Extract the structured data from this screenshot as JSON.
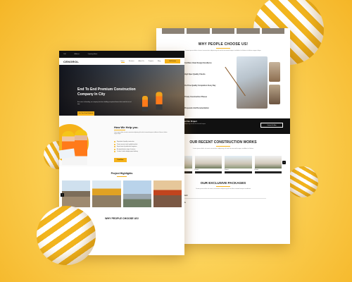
{
  "back_page": {
    "why_title": "WHY PEOPLE CHOOSE US!",
    "why_subtitle": "Lorem ipsum dolor sit amet consectetur adipiscing elit sed do eiusmod tempor incididunt ut labore et dolore magna aliqua",
    "features": [
      "Certified, Clear Design Excellence",
      "High Spec Quality Checks",
      "On-Time Quality Completion Every Day",
      "Timely Construction Phases",
      "Proposals And Documentation"
    ],
    "banner": {
      "title": "Any Further Question About Our Project",
      "text": "Lorem ipsum dolor sit amet consectetur adipiscing elit sed do eiusmod tempor",
      "button": "Contact Us Now"
    },
    "recent_title": "OUR RECENT CONSTRUCTION WORKS",
    "recent_subtitle": "Lorem ipsum dolor sit amet consectetur adipiscing elit sed do eiusmod tempor incididunt ut labore",
    "projects": [
      "Project",
      "Project",
      "Project",
      "Project"
    ],
    "packages_title": "OUR EXCLUSIVE PACKAGES",
    "packages_subtitle": "Lorem ipsum dolor sit amet consectetur adipiscing elit sed do eiusmod tempor incididunt",
    "package_rows": [
      "Standard",
      "Details"
    ]
  },
  "front_page": {
    "top_bar": [
      "Call",
      "Address",
      "Opening Hours"
    ],
    "logo": "CENGROL",
    "menu": [
      "Home",
      "Services",
      "About Us",
      "Projects",
      "Blog"
    ],
    "quote_button": "Get A Quote",
    "hero": {
      "title": "End To End Premium Construction Company In City",
      "text": "Ever since its founding, our company has been building exceptional homes that stand the test of time",
      "button": "Get Your Free Estimate"
    },
    "help": {
      "title": "How We Help you.",
      "text": "Lorem ipsum dolor sit amet consectetur adipiscing elit sed do eiusmod tempor incididunt ut labore et dolore magna aliqua",
      "items": [
        "Reputation & quality construction",
        "Proven success track in global markets",
        "Expert team of professional engineers",
        "A comprehensive range of services",
        "On-time & within budget project delivery"
      ],
      "button": "Read More"
    },
    "projects_title": "Project Highlights",
    "why_title": "WHY PEOPLE CHOOSE US!"
  }
}
